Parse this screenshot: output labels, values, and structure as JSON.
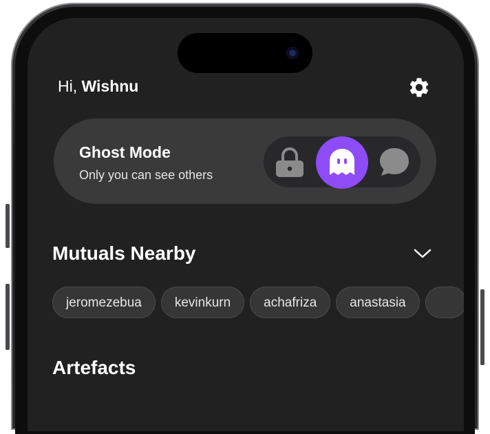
{
  "header": {
    "greeting_prefix": "Hi, ",
    "user_name": "Wishnu"
  },
  "ghost_mode": {
    "title": "Ghost Mode",
    "subtitle": "Only you can see others",
    "options": [
      {
        "icon": "lock-icon",
        "selected": false
      },
      {
        "icon": "ghost-icon",
        "selected": true
      },
      {
        "icon": "chat-bubble-icon",
        "selected": false
      }
    ]
  },
  "mutuals": {
    "title": "Mutuals Nearby",
    "chips": [
      "jeromezebua",
      "kevinkurn",
      "achafriza",
      "anastasia"
    ]
  },
  "artefacts": {
    "title": "Artefacts"
  },
  "colors": {
    "accent": "#8e4cf7",
    "background": "#212122",
    "card": "#3a3a3b"
  }
}
